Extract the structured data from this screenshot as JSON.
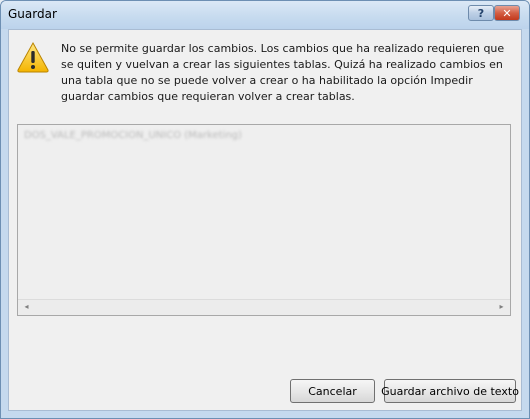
{
  "window": {
    "title": "Guardar",
    "help_glyph": "?",
    "close_glyph": "✕"
  },
  "message": {
    "text": "No se permite guardar los cambios. Los cambios que ha realizado requieren que se quiten y vuelvan a crear las siguientes tablas. Quizá ha realizado cambios en una tabla que no se puede volver a crear o ha habilitado la opción Impedir guardar cambios que requieran volver a crear tablas.",
    "icon": "warning-icon"
  },
  "list": {
    "items": [
      "DOS_VALE_PROMOCION_UNICO (Marketing)"
    ]
  },
  "scrollbar": {
    "left_glyph": "◂",
    "right_glyph": "▸"
  },
  "buttons": {
    "cancel_label": "Cancelar",
    "save_text_label": "Guardar archivo de texto"
  },
  "colors": {
    "titlebar": "#c7dbef",
    "client_bg": "#f0f0f0",
    "close_button": "#d35f44"
  }
}
